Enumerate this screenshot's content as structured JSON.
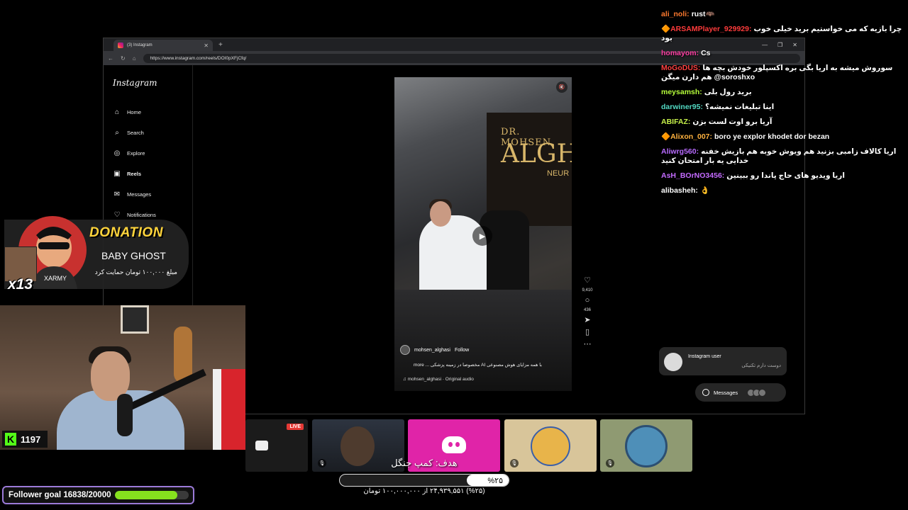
{
  "browser": {
    "tab_title": "(3) Instagram",
    "new_tab": "+",
    "url": "https://www.instagram.com/reels/DOI0pXFjCfq/"
  },
  "instagram": {
    "logo": "Instagram",
    "nav": [
      {
        "label": "Home",
        "icon": "home-icon"
      },
      {
        "label": "Search",
        "icon": "search-icon"
      },
      {
        "label": "Explore",
        "icon": "explore-icon"
      },
      {
        "label": "Reels",
        "icon": "reels-icon"
      },
      {
        "label": "Messages",
        "icon": "messages-icon"
      },
      {
        "label": "Notifications",
        "icon": "heart-icon"
      }
    ],
    "reel": {
      "brand_line1": "DR. MOHSEN",
      "brand_line2": "ALGH",
      "brand_line3": "NEUR",
      "author": "mohsen_alghasi",
      "follow": "Follow",
      "caption": "با همه مزایای هوش مصنوعی AI مخصوصا در زمینه پزشکی ... more",
      "audio": "mohsen_alghasi · Original audio"
    },
    "actions": {
      "likes": "9,410",
      "comments": "436"
    },
    "message_card": {
      "name": "Instagram user",
      "snippet": "دوست دارم تکنیکی"
    },
    "messages_pill": {
      "label": "Messages",
      "badge": "3"
    }
  },
  "chat": [
    {
      "user": "ali_noli:",
      "user_color": "#ff7a2f",
      "text": "rust🦇"
    },
    {
      "user": "🔶ARSAMPlayer_929929:",
      "user_color": "#ff3b3b",
      "text": "چرا بازیه که می خواستیم برید خیلی خوب بود"
    },
    {
      "user": "homayom:",
      "user_color": "#ff3fa4",
      "text": "Cs"
    },
    {
      "user": "MoGoDUS:",
      "user_color": "#ff4040",
      "text": "سوروش میشه به اریا بگی بره اکسپلور خودش بچه ها هم دارن میگن @soroshxo"
    },
    {
      "user": "meysamsh:",
      "user_color": "#b6ff3b",
      "text": "برید رول بلی"
    },
    {
      "user": "darwiner95:",
      "user_color": "#52d9c3",
      "text": "اینا تبلیغات نمیشه؟"
    },
    {
      "user": "ABIFAZ:",
      "user_color": "#c6f04a",
      "text": "آریا برو اوت لست بزن"
    },
    {
      "user": "🔶Alixon_007:",
      "user_color": "#ffb23f",
      "text": "boro ye explor khodet dor bezan"
    },
    {
      "user": "Aliwrg560:",
      "user_color": "#b86bff",
      "text": "اریا کالاف زامبی بزنید هم ویوش خوبه هم بازیش خفنه خدایی یه بار امتحان کنید"
    },
    {
      "user": "AsH_BOrNO3456:",
      "user_color": "#c46bff",
      "text": "اریا ویدیو های حاج پاندا رو ببینین"
    },
    {
      "user": "alibasheh:",
      "user_color": "#ffffff",
      "text": "👌"
    }
  ],
  "donation": {
    "title": "DONATION",
    "name": "BABY GHOST",
    "amount": "مبلغ ۱۰۰,۰۰۰ تومان حمایت کرد",
    "multiplier": "x13"
  },
  "kick": {
    "logo": "K",
    "viewers": "1197"
  },
  "panels": {
    "live": "LIVE"
  },
  "goal": {
    "title": "هدف: کمپ جنگل",
    "percent_label": "%۲۵",
    "percent": 25,
    "amount": "(%۲۵) ۲۴,۹۳۹,۵۵۱ از ۱۰۰,۰۰۰,۰۰۰ تومان"
  },
  "follower_goal": {
    "label": "Follower goal",
    "value": "16838/20000",
    "fraction": 0.8419
  }
}
